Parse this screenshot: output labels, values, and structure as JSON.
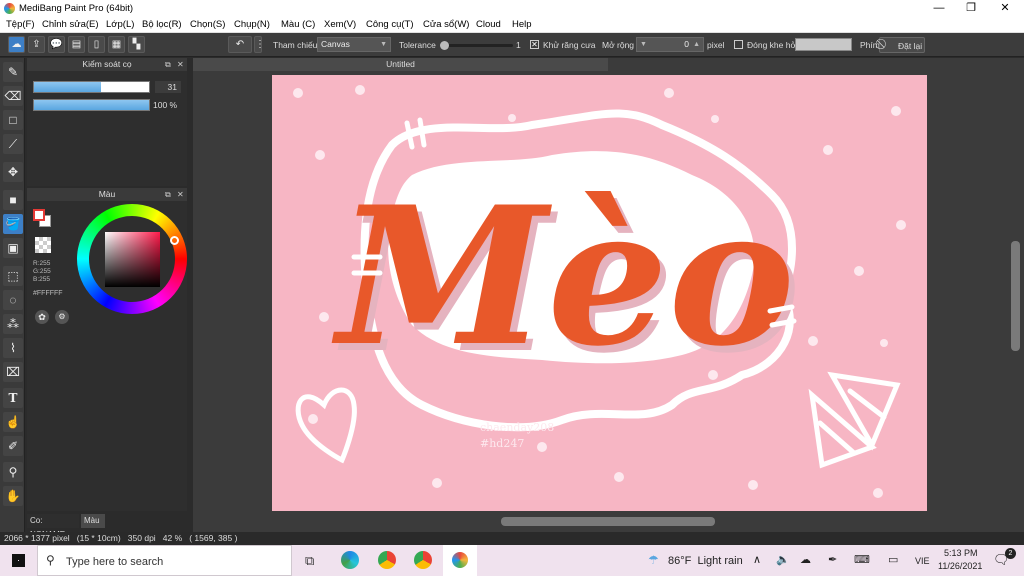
{
  "window": {
    "title": "MediBang Paint Pro (64bit)",
    "controls": [
      "—",
      "❐",
      "✕"
    ]
  },
  "menu": [
    "Tệp(F)",
    "Chỉnh sửa(E)",
    "Lớp(L)",
    "Bộ lọc(R)",
    "Chọn(S)",
    "Chụp(N)",
    "Màu (C)",
    "Xem(V)",
    "Công cụ(T)",
    "Cửa sổ(W)",
    "Cloud",
    "Help"
  ],
  "toolbar": {
    "reference_label": "Tham chiếu",
    "reference_value": "Canvas",
    "tolerance_label": "Tolerance",
    "tolerance_value": "1",
    "antialias_label": "Khử răng cưa",
    "expand_label": "Mở rộng",
    "expand_value": "0",
    "expand_unit": "pixel",
    "close_gap_label": "Đóng khe hở",
    "shortcut_label": "Phím",
    "reset_label": "Đặt lại"
  },
  "brush_panel": {
    "title": "Kiểm soát cọ",
    "size_value": "31",
    "size_fraction": 0.58,
    "opacity_value": "100 %",
    "opacity_fraction": 1.0
  },
  "color_panel": {
    "title": "Màu",
    "r": "R:255",
    "g": "G:255",
    "b": "B:255",
    "hex": "#FFFFFF"
  },
  "bottom_tabs": {
    "tab1": "Co: NONAME",
    "tab2": "Màu"
  },
  "document": {
    "tab_title": "Untitled",
    "artwork_title": "Mèo",
    "watermark_line1": "chaenday208",
    "watermark_line2": "#hd247"
  },
  "status": {
    "text": "2066 * 1377 pixel   (15 * 10cm)   350 dpi   42 %   ( 1569, 385 )"
  },
  "taskbar": {
    "search_placeholder": "Type here to search",
    "weather": "86°F  Light rain",
    "language": "VIE",
    "time": "5:13 PM",
    "date": "11/26/2021",
    "notification_count": "2"
  },
  "colors": {
    "canvas_pink": "#f7b6c4",
    "letter_orange": "#e8582a",
    "accent_blue": "#3d7fc6"
  }
}
